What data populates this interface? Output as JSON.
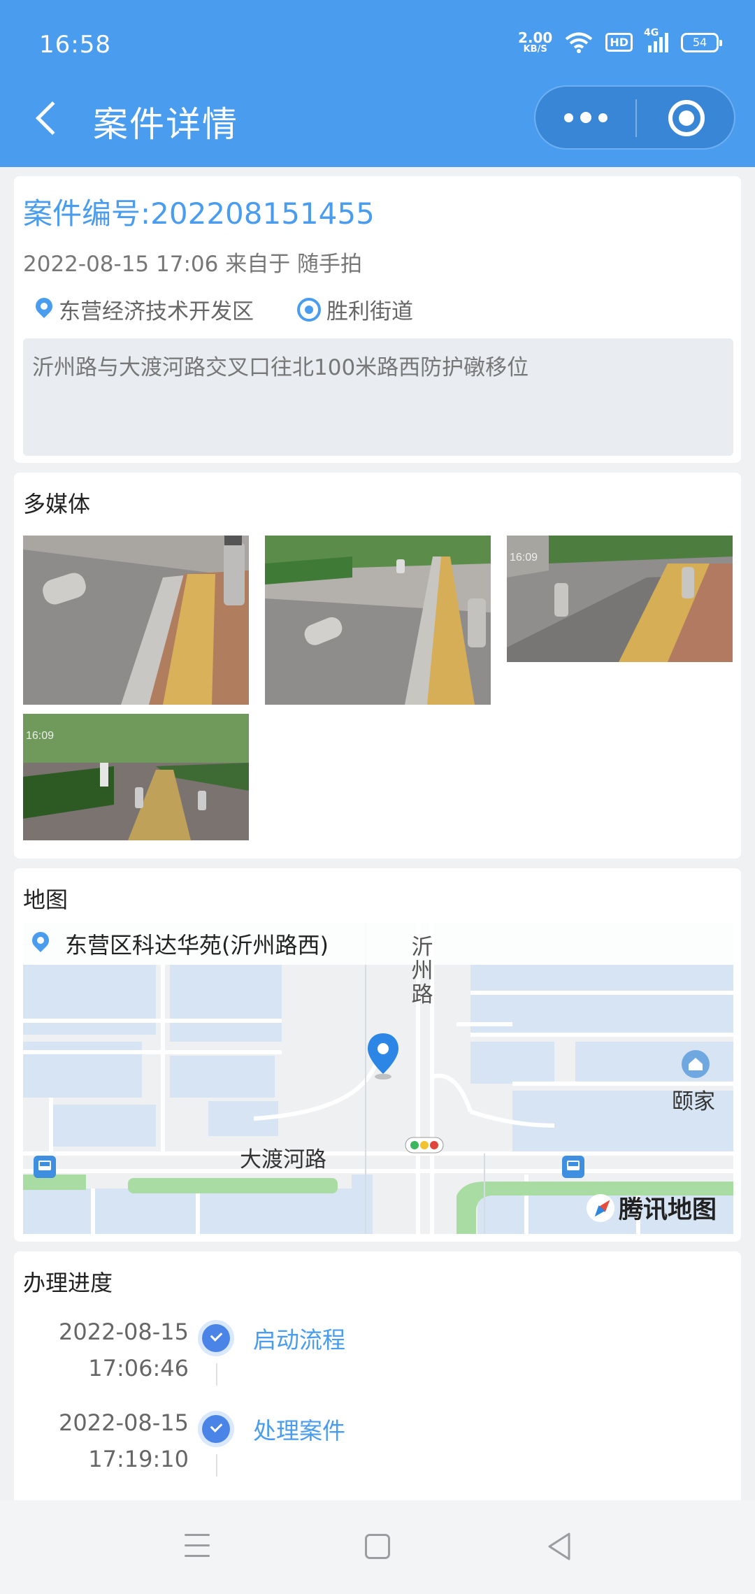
{
  "status_bar": {
    "time": "16:58",
    "net_speed": "2.00",
    "net_unit": "KB/S",
    "hd": "HD",
    "signal": "4G",
    "battery": "54"
  },
  "header": {
    "title": "案件详情"
  },
  "case": {
    "number_text": "案件编号:202208151455",
    "meta_text": "2022-08-15 17:06 来自于 随手拍",
    "district": "东营经济技术开发区",
    "street": "胜利街道",
    "description": "沂州路与大渡河路交叉口往北100米路西防护礅移位"
  },
  "media": {
    "title": "多媒体",
    "photos": [
      {
        "stamp": ""
      },
      {
        "stamp": ""
      },
      {
        "stamp": "16:09"
      },
      {
        "stamp": "16:09"
      }
    ]
  },
  "map": {
    "title": "地图",
    "address": "东营区科达华苑(沂州路西)",
    "labels": {
      "road_v": "沂州路",
      "road_h": "大渡河路",
      "poi": "颐家"
    },
    "provider": "腾讯地图"
  },
  "progress": {
    "title": "办理进度",
    "steps": [
      {
        "date": "2022-08-15",
        "time": "17:06:46",
        "label": "启动流程"
      },
      {
        "date": "2022-08-15",
        "time": "17:19:10",
        "label": "处理案件"
      }
    ]
  },
  "colors": {
    "primary": "#4a9cee",
    "background": "#f0f1f3",
    "desc_box": "#e9ecf0"
  }
}
